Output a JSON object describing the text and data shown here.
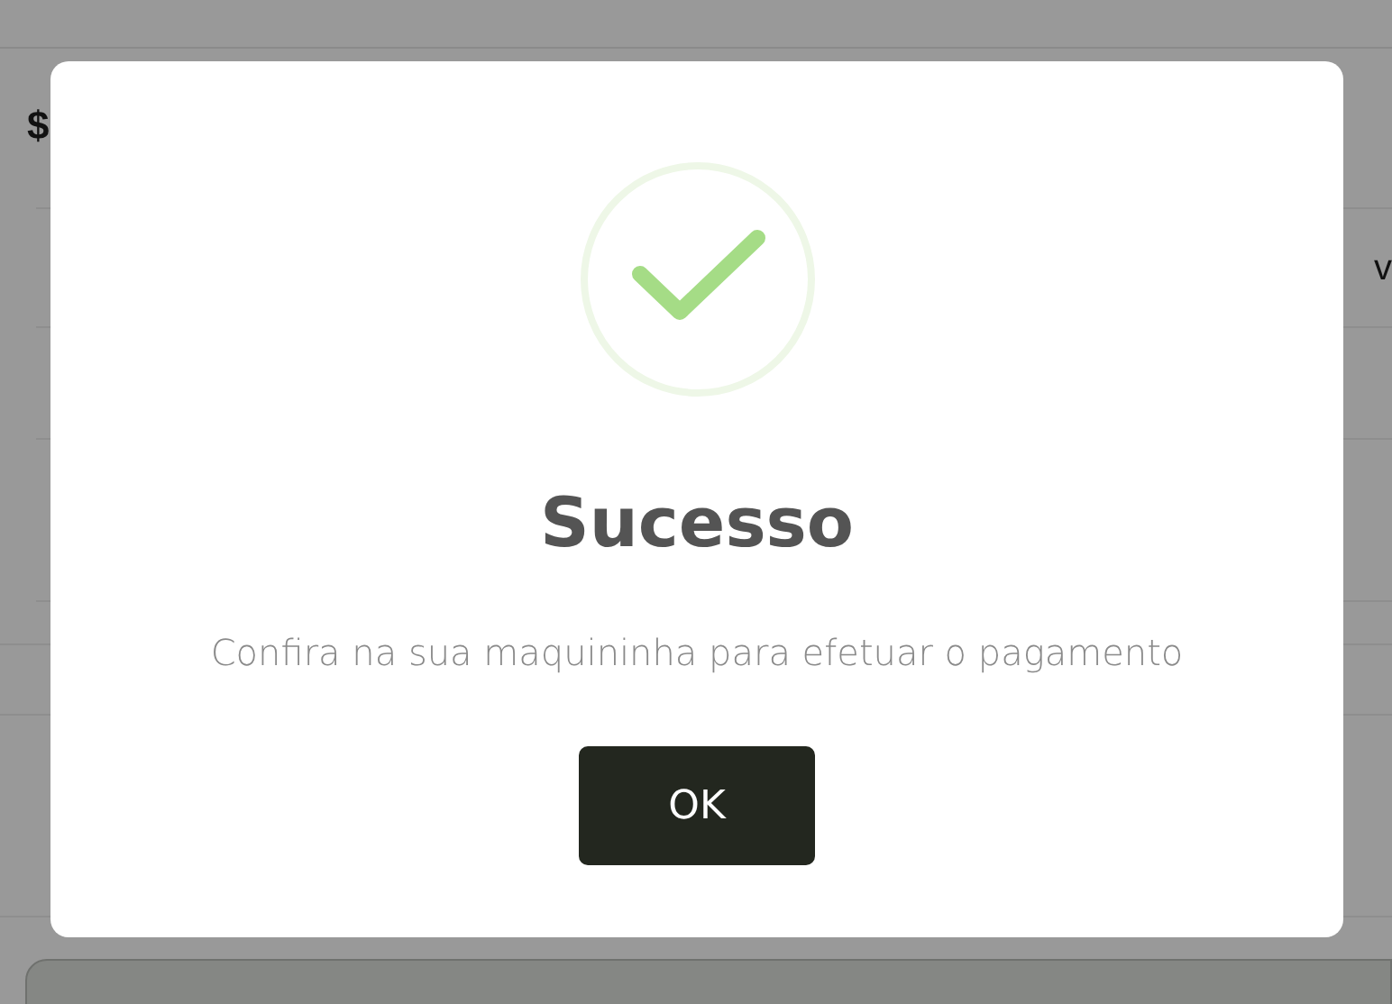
{
  "background": {
    "heading_fragment": "$",
    "cell_fragment": "v"
  },
  "dialog": {
    "title": "Sucesso",
    "message": "Confira na sua maquininha para efetuar o pagamento",
    "button": "OK"
  }
}
